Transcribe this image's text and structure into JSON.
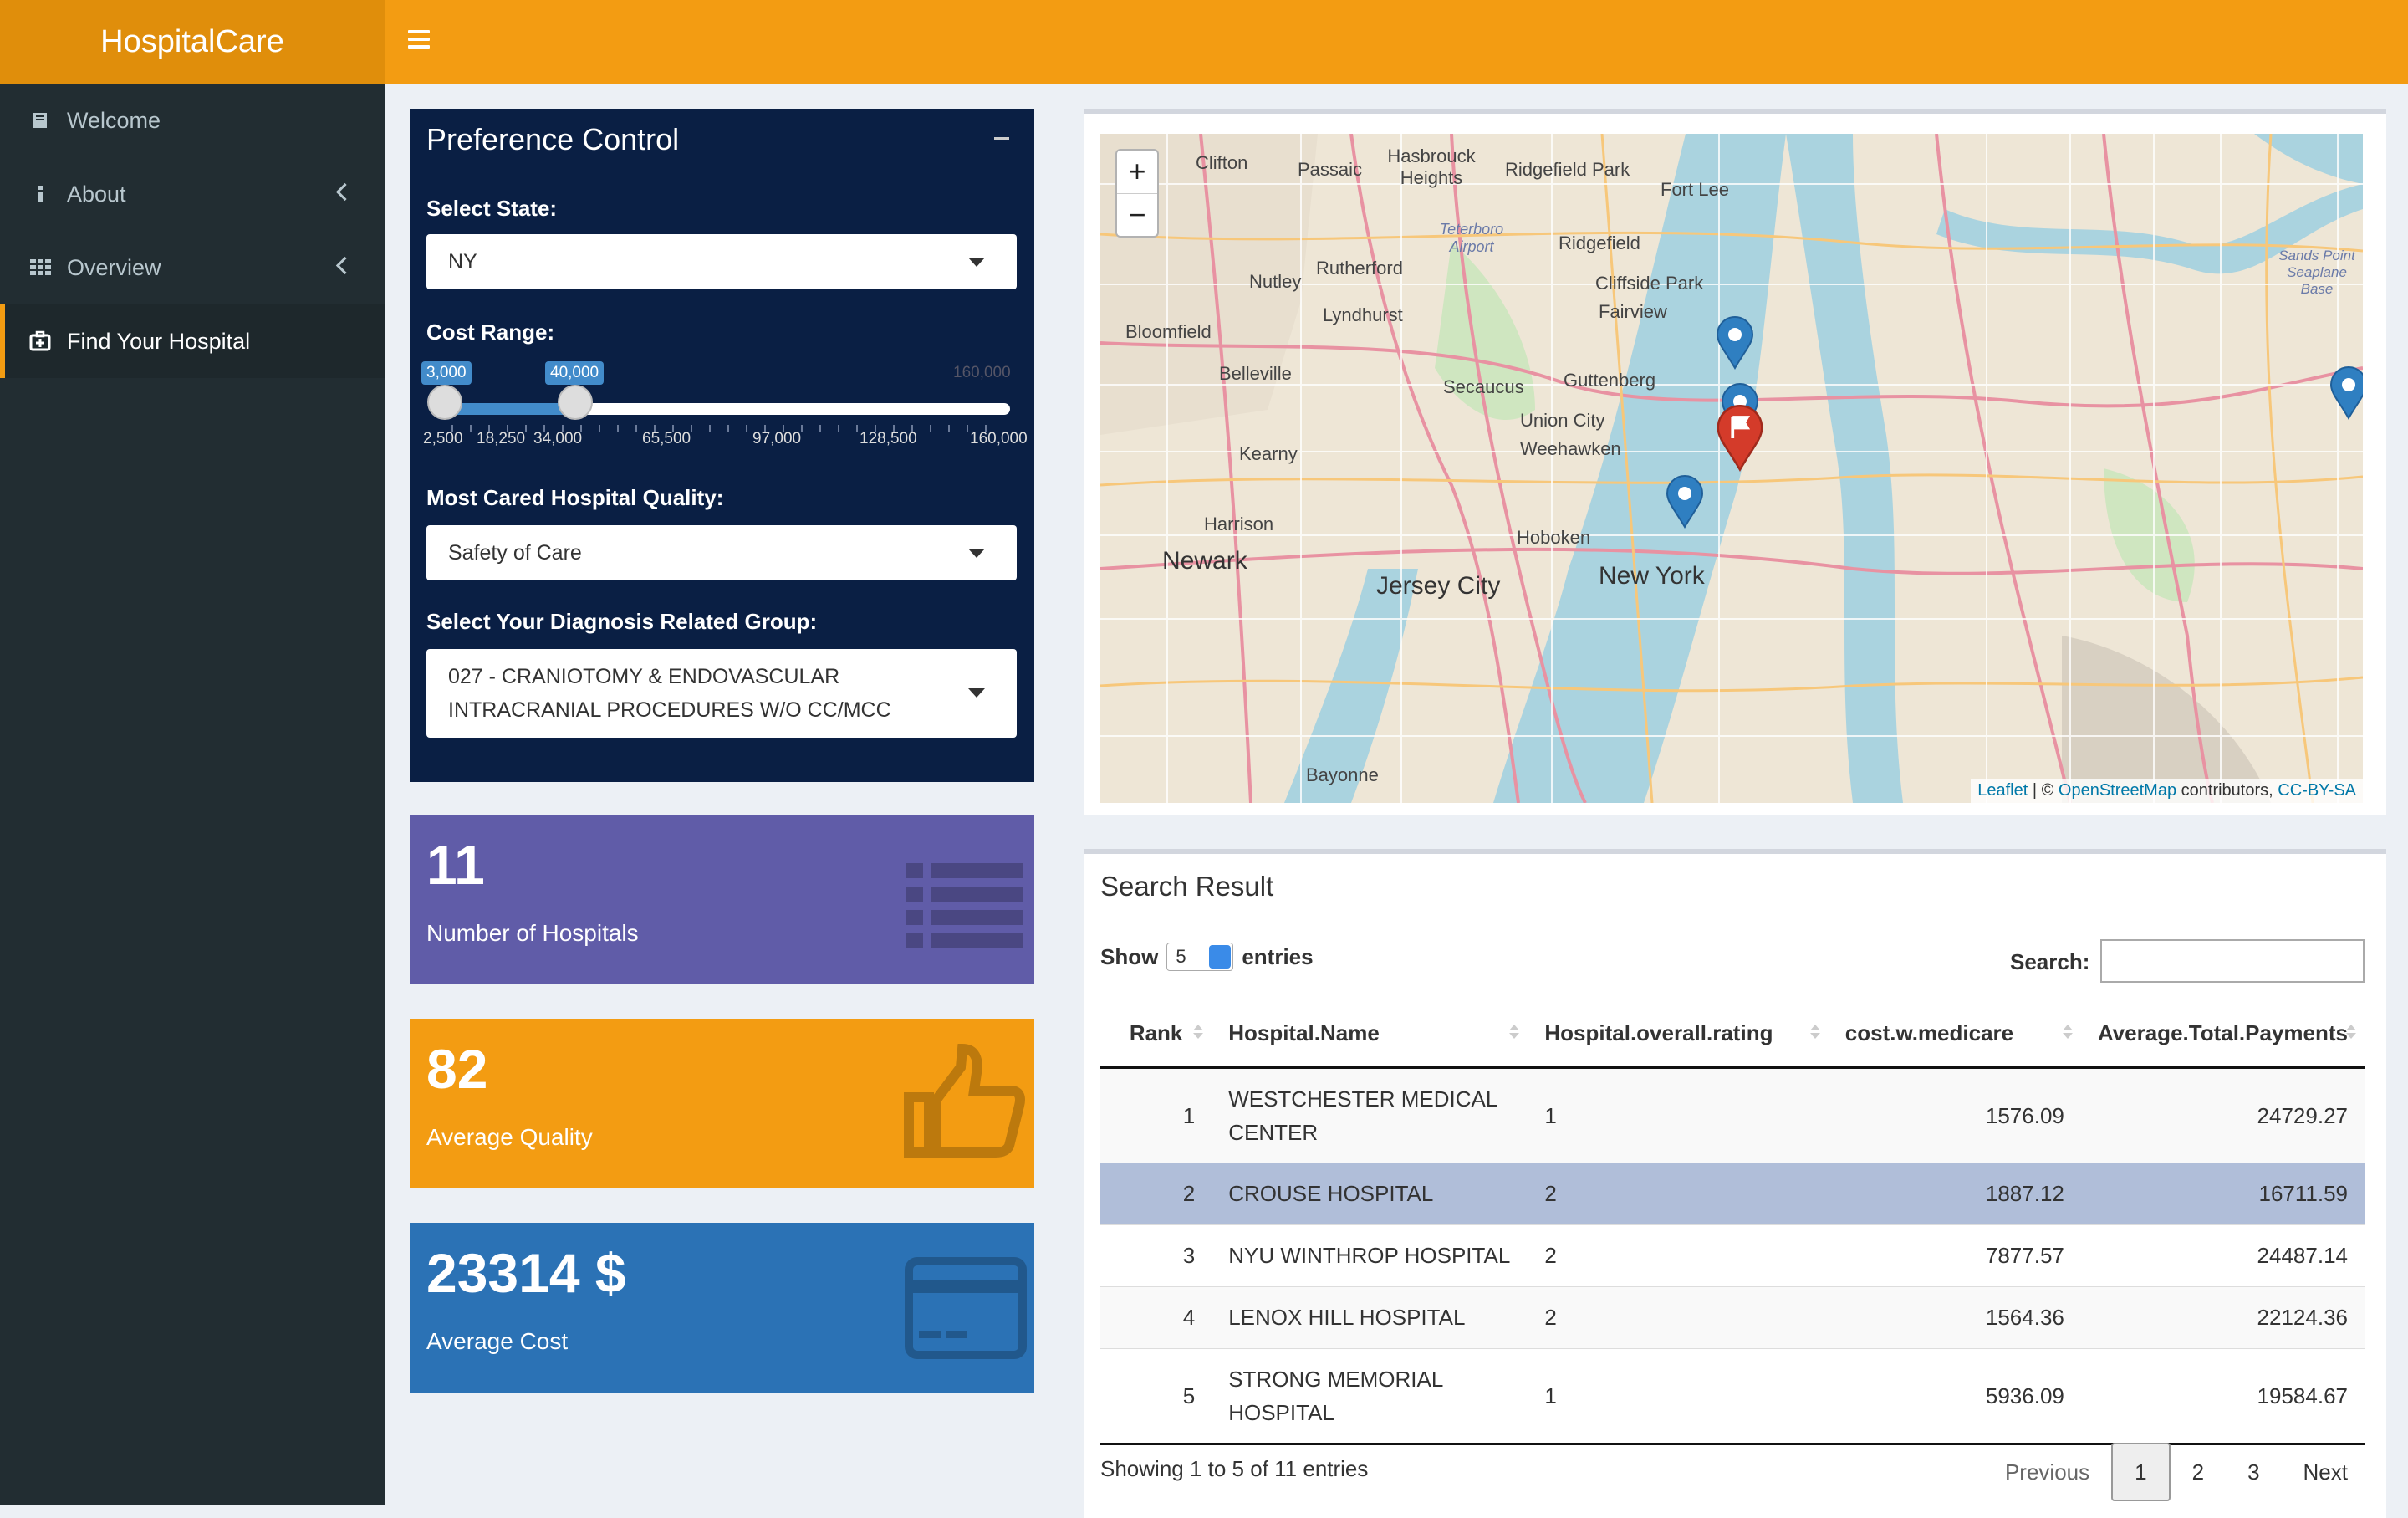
{
  "app": {
    "title": "HospitalCare"
  },
  "sidebar": {
    "items": [
      {
        "label": "Welcome",
        "icon": "book-icon"
      },
      {
        "label": "About",
        "icon": "info-icon"
      },
      {
        "label": "Overview",
        "icon": "grid-icon"
      },
      {
        "label": "Find Your Hospital",
        "icon": "hospital-icon"
      }
    ]
  },
  "preference": {
    "title": "Preference Control",
    "state_label": "Select State:",
    "state_value": "NY",
    "cost_label": "Cost Range:",
    "cost_low": "3,000",
    "cost_high": "40,000",
    "cost_max": "160,000",
    "ticks": [
      "2,500",
      "18,250",
      "34,000",
      "65,500",
      "97,000",
      "128,500",
      "160,000"
    ],
    "quality_label": "Most Cared Hospital Quality:",
    "quality_value": "Safety of Care",
    "drg_label": "Select Your Diagnosis Related Group:",
    "drg_value": "027 - CRANIOTOMY & ENDOVASCULAR INTRACRANIAL PROCEDURES W/O CC/MCC"
  },
  "boxes": [
    {
      "value": "11",
      "label": "Number of Hospitals",
      "color": "#605ca8"
    },
    {
      "value": "82",
      "label": "Average Quality",
      "color": "#f39c12"
    },
    {
      "value": "23314 $",
      "label": "Average Cost",
      "color": "#2b72b5"
    }
  ],
  "map": {
    "zoom_in": "+",
    "zoom_out": "−",
    "attr_leaflet": "Leaflet",
    "attr_sep": " | © ",
    "attr_osm": "OpenStreetMap",
    "attr_contrib": " contributors, ",
    "attr_cc": "CC-BY-SA",
    "labels": [
      "Clifton",
      "Passaic",
      "Hasbrouck Heights",
      "Ridgefield Park",
      "Fort Lee",
      "Nutley",
      "Rutherford",
      "Ridgefield",
      "Cliffside Park",
      "Bloomfield",
      "Lyndhurst",
      "Fairview",
      "Belleville",
      "Secaucus",
      "Guttenberg",
      "Union City",
      "Weehawken",
      "Kearny",
      "Harrison",
      "Hoboken",
      "Jersey City",
      "Newark",
      "New York",
      "Bayonne",
      "Teterboro Airport",
      "Sands Point Seaplane Base"
    ]
  },
  "results": {
    "title": "Search Result",
    "show_label": "Show",
    "show_value": "5",
    "entries_label": "entries",
    "search_label": "Search:",
    "columns": [
      "Rank",
      "Hospital.Name",
      "Hospital.overall.rating",
      "cost.w.medicare",
      "Average.Total.Payments"
    ],
    "rows": [
      [
        "1",
        "WESTCHESTER MEDICAL CENTER",
        "1",
        "1576.09",
        "24729.27"
      ],
      [
        "2",
        "CROUSE HOSPITAL",
        "2",
        "1887.12",
        "16711.59"
      ],
      [
        "3",
        "NYU WINTHROP HOSPITAL",
        "2",
        "7877.57",
        "24487.14"
      ],
      [
        "4",
        "LENOX HILL HOSPITAL",
        "2",
        "1564.36",
        "22124.36"
      ],
      [
        "5",
        "STRONG MEMORIAL HOSPITAL",
        "1",
        "5936.09",
        "19584.67"
      ]
    ],
    "info": "Showing 1 to 5 of 11 entries",
    "pager": [
      "Previous",
      "1",
      "2",
      "3",
      "Next"
    ]
  }
}
